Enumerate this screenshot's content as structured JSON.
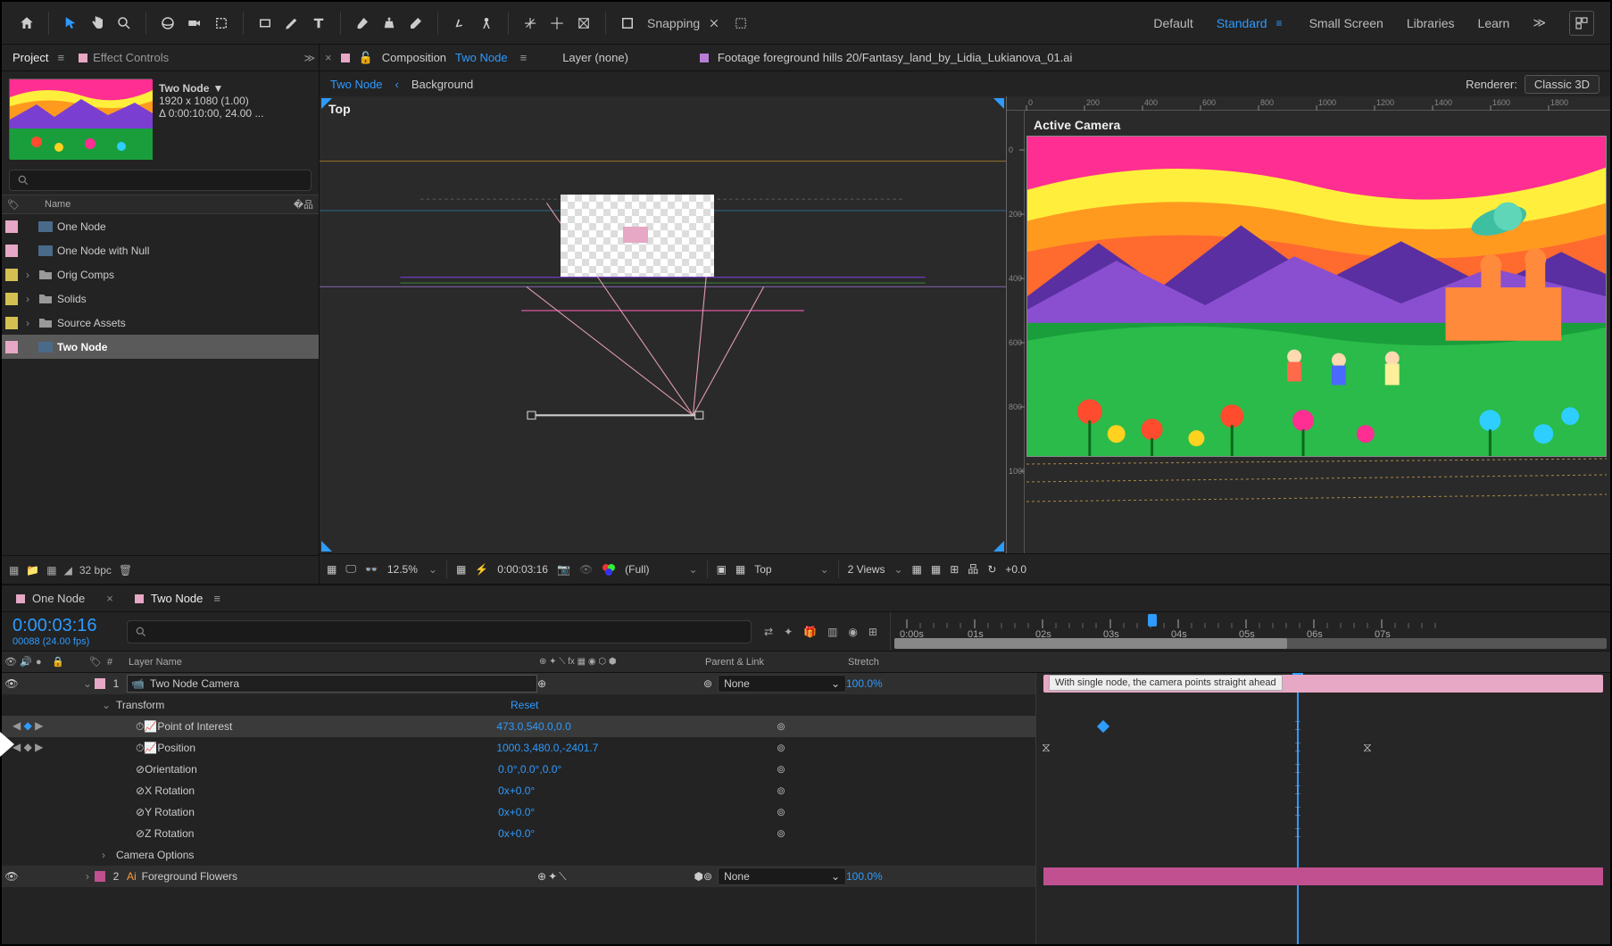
{
  "toolbar": {
    "snapping_label": "Snapping"
  },
  "workspaces": {
    "default": "Default",
    "standard": "Standard",
    "small_screen": "Small Screen",
    "libraries": "Libraries",
    "learn": "Learn"
  },
  "project": {
    "tab_project": "Project",
    "tab_effect_controls": "Effect Controls",
    "comp_name": "Two Node",
    "dims": "1920 x 1080 (1.00)",
    "duration": "Δ 0:00:10:00, 24.00 ...",
    "col_name": "Name",
    "items": [
      {
        "name": "One Node",
        "type": "comp",
        "swatch": "sw-pink"
      },
      {
        "name": "One Node with Null",
        "type": "comp",
        "swatch": "sw-pink"
      },
      {
        "name": "Orig Comps",
        "type": "folder",
        "swatch": "sw-yellow"
      },
      {
        "name": "Solids",
        "type": "folder",
        "swatch": "sw-yellow"
      },
      {
        "name": "Source Assets",
        "type": "folder",
        "swatch": "sw-yellow"
      },
      {
        "name": "Two Node",
        "type": "comp",
        "swatch": "sw-pink",
        "selected": true
      }
    ],
    "bpc": "32 bpc"
  },
  "comp": {
    "tab_prefix": "Composition",
    "tab_name": "Two Node",
    "layer_tab": "Layer (none)",
    "footage_tab": "Footage foreground hills 20/Fantasy_land_by_Lidia_Lukianova_01.ai",
    "bc_current": "Two Node",
    "bc_other": "Background",
    "renderer_label": "Renderer:",
    "renderer_value": "Classic 3D",
    "view_top": "Top",
    "view_active": "Active Camera",
    "footer": {
      "zoom": "12.5%",
      "time": "0:00:03:16",
      "res": "(Full)",
      "cam": "Top",
      "views": "2 Views",
      "exposure": "+0.0"
    },
    "ruler_right_ticks": [
      "0",
      "200",
      "400",
      "600",
      "800",
      "1000",
      "1200",
      "1400",
      "1600",
      "1800"
    ],
    "ruler_right_y": [
      "0",
      "200",
      "400",
      "600",
      "800",
      "1000"
    ]
  },
  "timeline": {
    "tabs": [
      "One Node",
      "Two Node"
    ],
    "time": "0:00:03:16",
    "frame_info": "00088 (24.00 fps)",
    "col_layer_name": "Layer Name",
    "col_parent": "Parent & Link",
    "col_stretch": "Stretch",
    "col_num": "#",
    "ruler": [
      "0:00s",
      "01s",
      "02s",
      "03s",
      "04s",
      "05s",
      "06s",
      "07s"
    ],
    "layers": [
      {
        "num": "1",
        "name": "Two Node Camera",
        "parent": "None",
        "stretch": "100.0%",
        "swatch": "sw-pink",
        "icon": "camera"
      },
      {
        "num": "2",
        "name": "Foreground Flowers",
        "parent": "None",
        "stretch": "100.0%",
        "swatch": "sw-mag",
        "icon": "ai"
      }
    ],
    "transform_label": "Transform",
    "transform_reset": "Reset",
    "camera_options": "Camera Options",
    "props": [
      {
        "name": "Point of Interest",
        "value": "473.0,540.0,0.0",
        "kf": true,
        "sel": true
      },
      {
        "name": "Position",
        "value": "1000.3,480.0,-2401.7",
        "kf": true
      },
      {
        "name": "Orientation",
        "value": "0.0°,0.0°,0.0°"
      },
      {
        "name": "X Rotation",
        "value": "0x+0.0°"
      },
      {
        "name": "Y Rotation",
        "value": "0x+0.0°"
      },
      {
        "name": "Z Rotation",
        "value": "0x+0.0°"
      }
    ],
    "marker_text": "With single node, the camera points straight ahead"
  }
}
